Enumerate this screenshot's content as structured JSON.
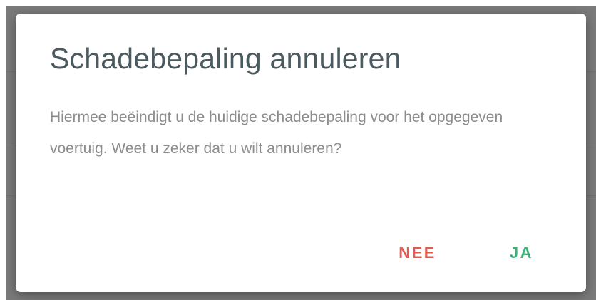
{
  "dialog": {
    "title": "Schadebepaling annuleren",
    "message": "Hiermee beëindigt u de huidige schadebepaling voor het opgegeven voertuig. Weet u zeker dat u wilt annuleren?",
    "buttons": {
      "no_label": "NEE",
      "yes_label": "JA"
    }
  },
  "colors": {
    "title_text": "#4b5a61",
    "body_text": "#8c8c8c",
    "no_button": "#e55a4f",
    "yes_button": "#39b27a",
    "overlay": "#7a7a7a"
  }
}
